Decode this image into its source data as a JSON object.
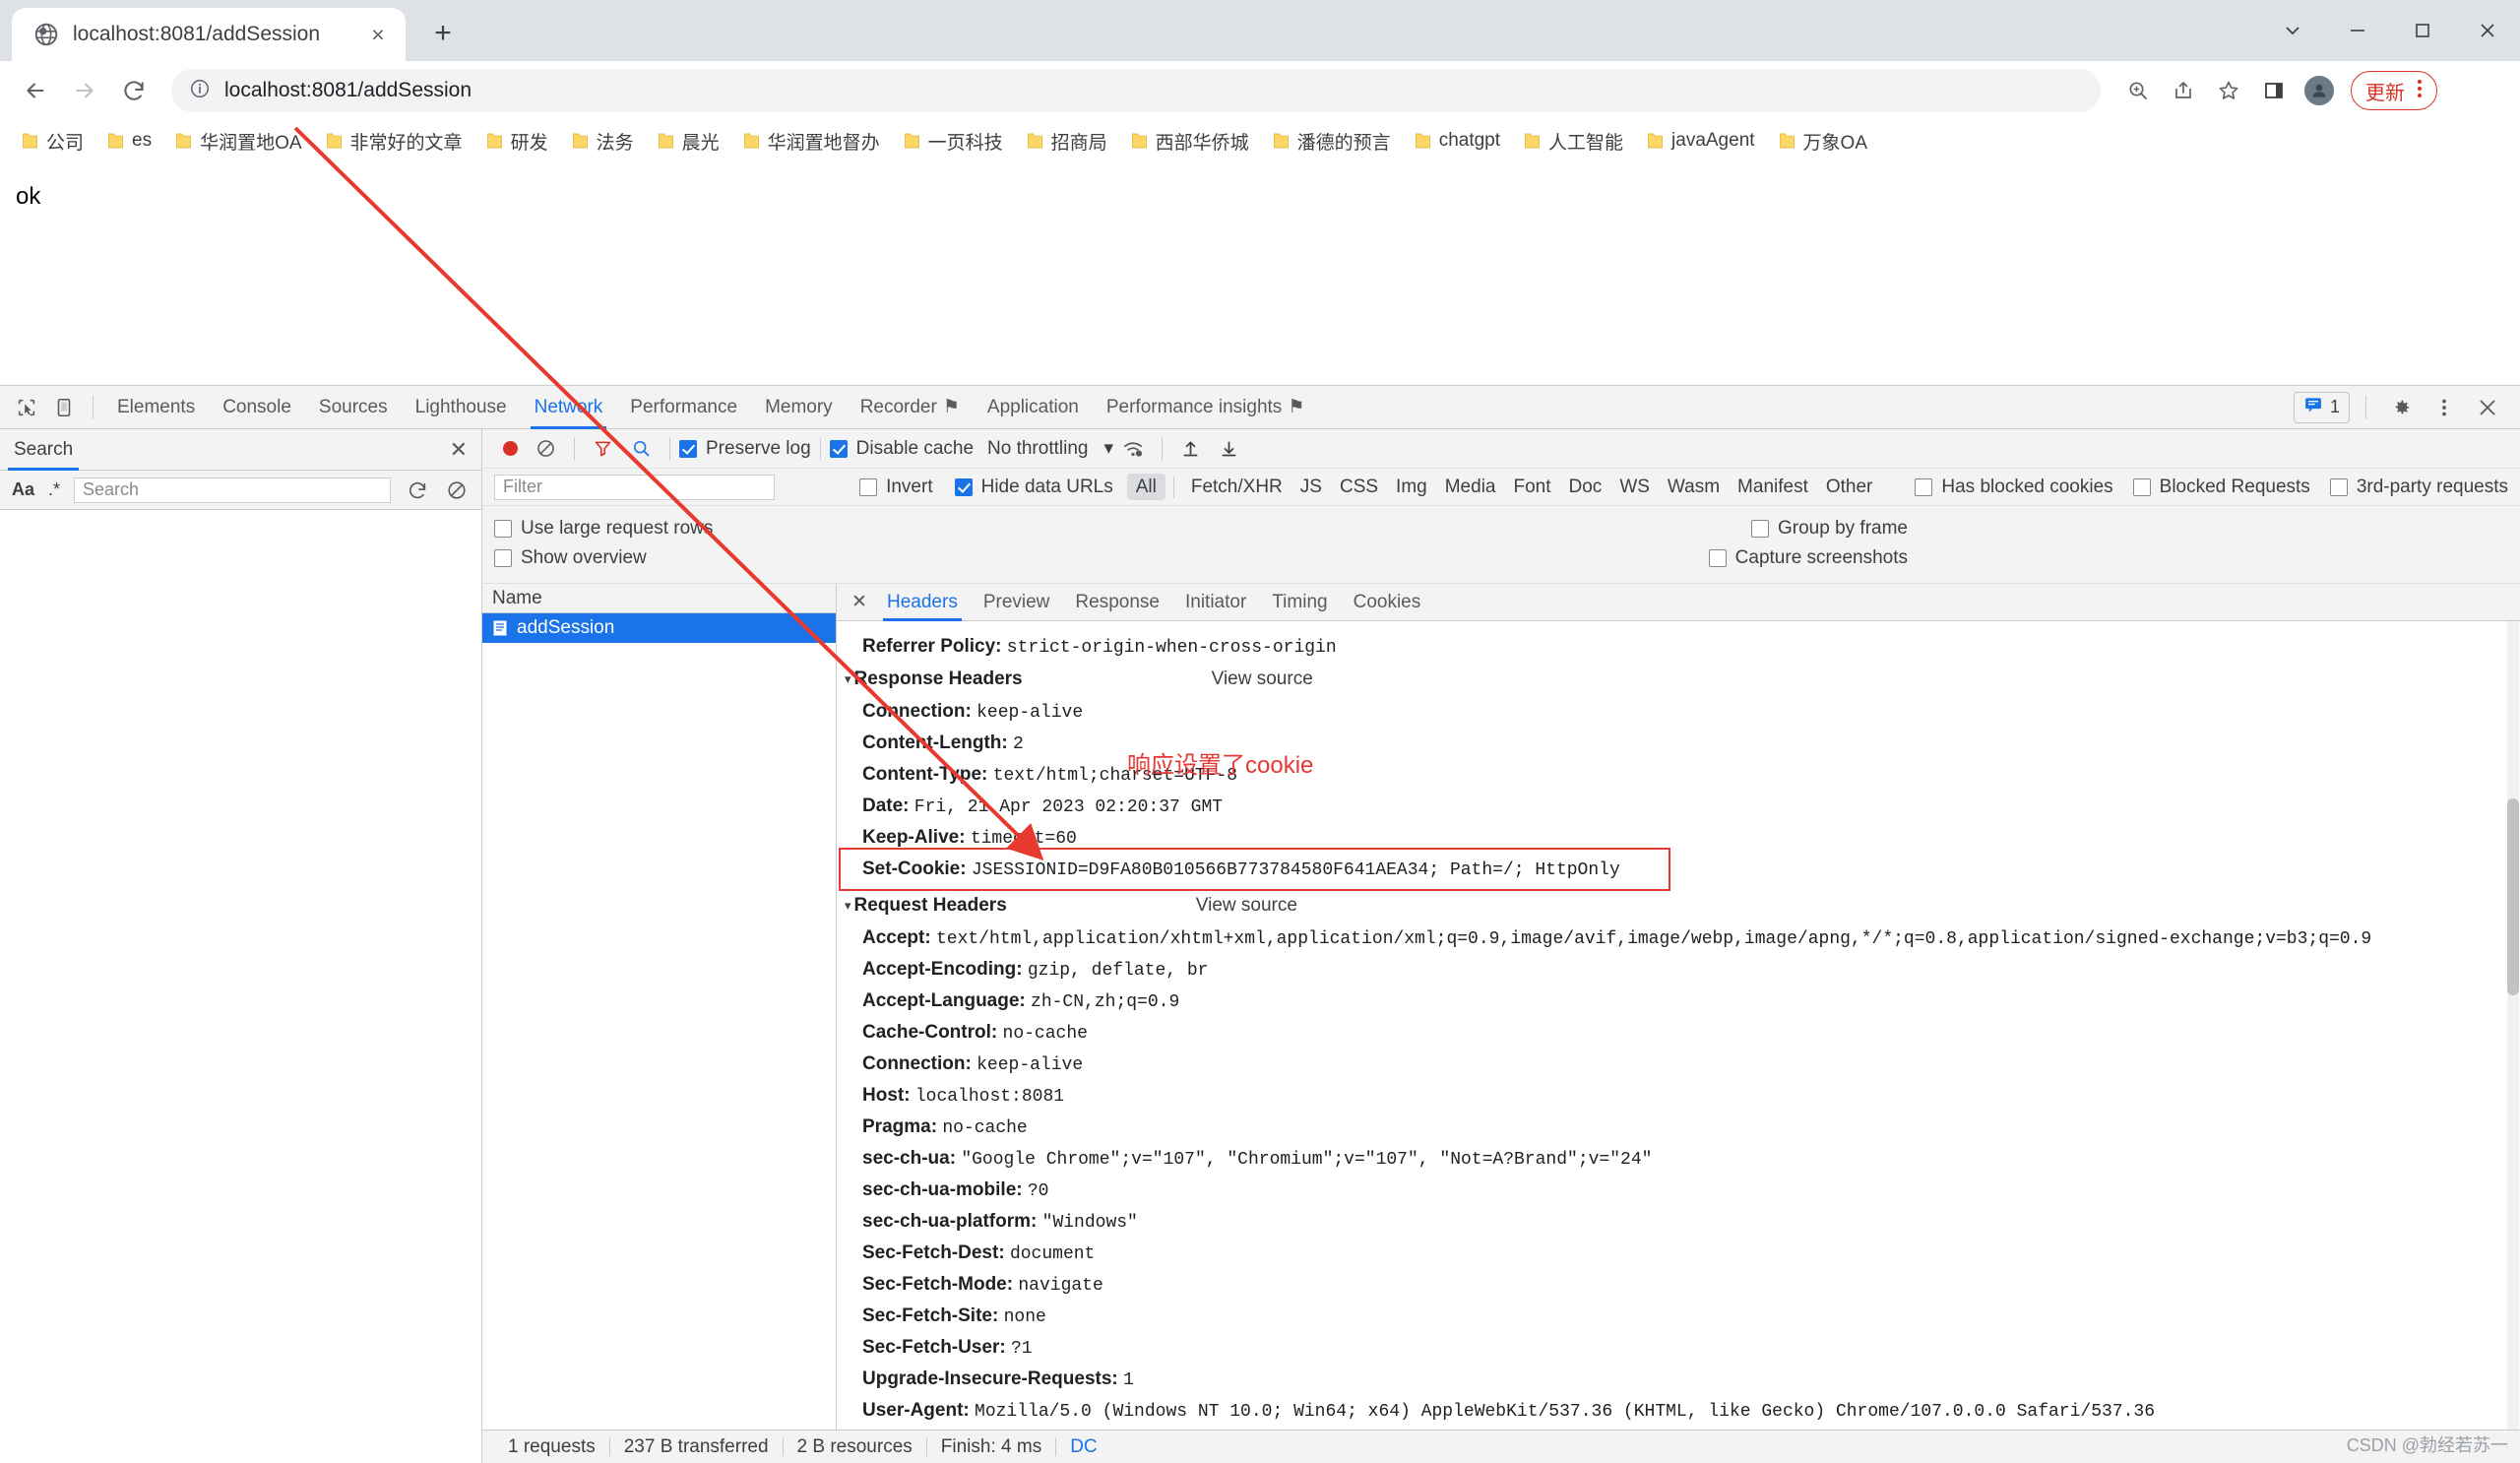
{
  "browser": {
    "tab": {
      "title": "localhost:8081/addSession",
      "favicon": "globe-icon",
      "close": "×"
    },
    "newtab_label": "+",
    "window_controls": {
      "minimize": "─",
      "maximize": "□",
      "close": "✕",
      "more_tabs": "⌄"
    },
    "omnibox": {
      "value": "localhost:8081/addSession",
      "scheme_prefix": "localhost:8081",
      "path": "/addSession",
      "info_icon": "info-circle-icon"
    },
    "nav": {
      "back": "←",
      "forward": "→",
      "reload": "⟳"
    },
    "actions": {
      "zoom_icon": "zoom-search-icon",
      "share_icon": "share-icon",
      "bookmark_icon": "star-icon",
      "sidepanel_icon": "side-panel-icon",
      "profile_icon": "profile-avatar-icon",
      "update_label": "更新",
      "menu_icon": "three-dot-menu-icon"
    },
    "bookmarks": [
      {
        "label": "公司"
      },
      {
        "label": "es"
      },
      {
        "label": "华润置地OA"
      },
      {
        "label": "非常好的文章"
      },
      {
        "label": "研发"
      },
      {
        "label": "法务"
      },
      {
        "label": "晨光"
      },
      {
        "label": "华润置地督办"
      },
      {
        "label": "一页科技"
      },
      {
        "label": "招商局"
      },
      {
        "label": "西部华侨城"
      },
      {
        "label": "潘德的预言"
      },
      {
        "label": "chatgpt"
      },
      {
        "label": "人工智能"
      },
      {
        "label": "javaAgent"
      },
      {
        "label": "万象OA"
      }
    ]
  },
  "page": {
    "body_text": "ok"
  },
  "devtools": {
    "left_icons": {
      "inspect": "inspect-element-icon",
      "device": "device-toolbar-icon"
    },
    "panels": [
      {
        "label": "Elements",
        "active": false
      },
      {
        "label": "Console",
        "active": false
      },
      {
        "label": "Sources",
        "active": false
      },
      {
        "label": "Lighthouse",
        "active": false
      },
      {
        "label": "Network",
        "active": true
      },
      {
        "label": "Performance",
        "active": false
      },
      {
        "label": "Memory",
        "active": false
      },
      {
        "label": "Recorder",
        "active": false,
        "badge": "⚑"
      },
      {
        "label": "Application",
        "active": false
      },
      {
        "label": "Performance insights",
        "active": false,
        "badge": "⚑"
      }
    ],
    "right": {
      "issues_count": "1",
      "issues_icon": "issues-message-icon",
      "settings_icon": "gear-icon",
      "more_icon": "three-dot-menu-icon",
      "close_icon": "close-icon"
    },
    "search_panel": {
      "title": "Search",
      "close": "✕",
      "match_case_label": "Aa",
      "regex_label": ".*",
      "input_placeholder": "Search",
      "refresh_icon": "refresh-icon",
      "clear_icon": "clear-icon"
    },
    "network_toolbar": {
      "record_icon": "record-stop-icon",
      "clear_icon": "clear-network-icon",
      "filter_icon": "filter-funnel-icon",
      "search_icon": "search-icon",
      "preserve_log_label": "Preserve log",
      "preserve_log_checked": true,
      "disable_cache_label": "Disable cache",
      "disable_cache_checked": true,
      "throttling_value": "No throttling",
      "throttling_caret": "▾",
      "wifi_icon": "network-conditions-icon",
      "import_icon": "import-har-icon",
      "export_icon": "export-har-icon"
    },
    "filter_bar": {
      "filter_placeholder": "Filter",
      "invert_label": "Invert",
      "invert_checked": false,
      "hide_data_urls_label": "Hide data URLs",
      "hide_data_urls_checked": true,
      "types": [
        "All",
        "Fetch/XHR",
        "JS",
        "CSS",
        "Img",
        "Media",
        "Font",
        "Doc",
        "WS",
        "Wasm",
        "Manifest",
        "Other"
      ],
      "selected_type": "All",
      "has_blocked_cookies_label": "Has blocked cookies",
      "blocked_requests_label": "Blocked Requests",
      "third_party_label": "3rd-party requests"
    },
    "options": {
      "use_large_request_rows": "Use large request rows",
      "show_overview": "Show overview",
      "group_by_frame": "Group by frame",
      "capture_screenshots": "Capture screenshots"
    },
    "request_list": {
      "column_name": "Name",
      "rows": [
        {
          "name": "addSession",
          "icon": "document-icon",
          "selected": true
        }
      ]
    },
    "detail_tabs": [
      {
        "label": "Headers",
        "active": true
      },
      {
        "label": "Preview",
        "active": false
      },
      {
        "label": "Response",
        "active": false
      },
      {
        "label": "Initiator",
        "active": false
      },
      {
        "label": "Timing",
        "active": false
      },
      {
        "label": "Cookies",
        "active": false
      }
    ],
    "detail_close": "✕",
    "headers": {
      "top_line": {
        "key": "Referrer Policy:",
        "value": "strict-origin-when-cross-origin"
      },
      "response_section": {
        "title": "Response Headers",
        "view_source": "View source",
        "caret": "▾",
        "rows": [
          {
            "key": "Connection:",
            "value": "keep-alive"
          },
          {
            "key": "Content-Length:",
            "value": "2"
          },
          {
            "key": "Content-Type:",
            "value": "text/html;charset=UTF-8"
          },
          {
            "key": "Date:",
            "value": "Fri, 21 Apr 2023 02:20:37 GMT"
          },
          {
            "key": "Keep-Alive:",
            "value": "timeout=60"
          },
          {
            "key": "Set-Cookie:",
            "value": "JSESSIONID=D9FA80B010566B773784580F641AEA34; Path=/; HttpOnly",
            "highlighted": true
          }
        ]
      },
      "request_section": {
        "title": "Request Headers",
        "view_source": "View source",
        "caret": "▾",
        "rows": [
          {
            "key": "Accept:",
            "value": "text/html,application/xhtml+xml,application/xml;q=0.9,image/avif,image/webp,image/apng,*/*;q=0.8,application/signed-exchange;v=b3;q=0.9"
          },
          {
            "key": "Accept-Encoding:",
            "value": "gzip, deflate, br"
          },
          {
            "key": "Accept-Language:",
            "value": "zh-CN,zh;q=0.9"
          },
          {
            "key": "Cache-Control:",
            "value": "no-cache"
          },
          {
            "key": "Connection:",
            "value": "keep-alive"
          },
          {
            "key": "Host:",
            "value": "localhost:8081"
          },
          {
            "key": "Pragma:",
            "value": "no-cache"
          },
          {
            "key": "sec-ch-ua:",
            "value": "\"Google Chrome\";v=\"107\", \"Chromium\";v=\"107\", \"Not=A?Brand\";v=\"24\""
          },
          {
            "key": "sec-ch-ua-mobile:",
            "value": "?0"
          },
          {
            "key": "sec-ch-ua-platform:",
            "value": "\"Windows\""
          },
          {
            "key": "Sec-Fetch-Dest:",
            "value": "document"
          },
          {
            "key": "Sec-Fetch-Mode:",
            "value": "navigate"
          },
          {
            "key": "Sec-Fetch-Site:",
            "value": "none"
          },
          {
            "key": "Sec-Fetch-User:",
            "value": "?1"
          },
          {
            "key": "Upgrade-Insecure-Requests:",
            "value": "1"
          },
          {
            "key": "User-Agent:",
            "value": "Mozilla/5.0 (Windows NT 10.0; Win64; x64) AppleWebKit/537.36 (KHTML, like Gecko) Chrome/107.0.0.0 Safari/537.36"
          }
        ]
      }
    },
    "status_bar": {
      "requests": "1 requests",
      "transferred": "237 B transferred",
      "resources": "2 B resources",
      "finish": "Finish: 4 ms",
      "dc": "DC"
    }
  },
  "annotations": {
    "cookie_note": "响应设置了cookie",
    "arrow_color": "#e8392e",
    "highlight_color": "#e53935"
  },
  "watermark": "CSDN @勃经若苏一"
}
